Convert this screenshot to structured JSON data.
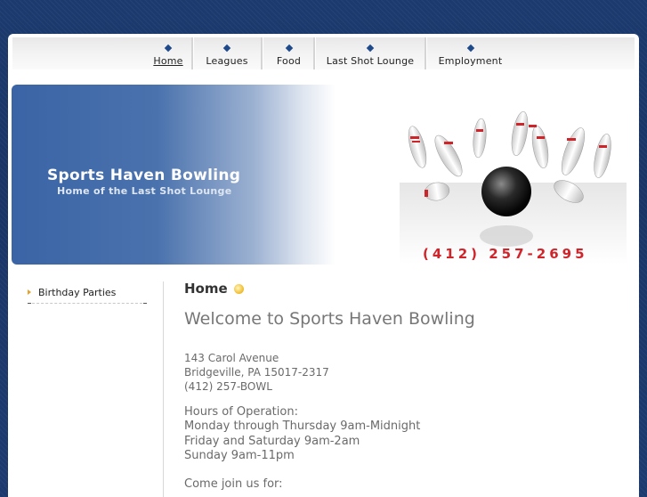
{
  "nav": {
    "items": [
      {
        "label": "Home",
        "active": true
      },
      {
        "label": "Leagues"
      },
      {
        "label": "Food"
      },
      {
        "label": "Last Shot Lounge"
      },
      {
        "label": "Employment"
      }
    ]
  },
  "banner": {
    "title": "Sports Haven Bowling",
    "subtitle": "Home of the Last Shot Lounge",
    "phone": "(412) 257-2695",
    "image_icon": "bowling-pins-icon"
  },
  "sidebar": {
    "items": [
      {
        "label": "Birthday Parties"
      }
    ]
  },
  "main": {
    "heading": "Home",
    "welcome": "Welcome to Sports Haven Bowling",
    "address": [
      "143 Carol Avenue",
      "Bridgeville, PA 15017-2317",
      "(412) 257-BOWL"
    ],
    "hours": [
      "Hours of Operation:",
      "Monday through Thursday 9am-Midnight",
      "Friday and Saturday 9am-2am",
      "Sunday 9am-11pm"
    ],
    "join": "Come join us for:"
  },
  "colors": {
    "accent": "#1e4a8c",
    "phone": "#d0242b",
    "sidebar_arrow": "#e8a030"
  }
}
